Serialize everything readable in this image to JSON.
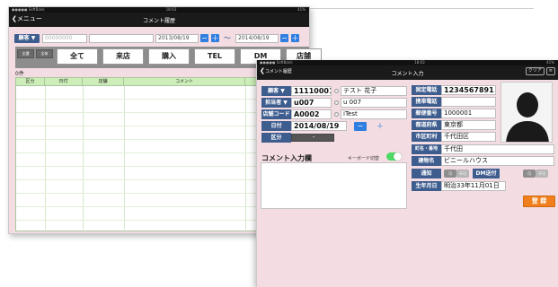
{
  "back": {
    "status": {
      "carrier": "●●●●● SoftBank",
      "time": "18:03",
      "battery": "41%"
    },
    "nav": {
      "back_label": "メニュー",
      "title": "コメント履歴"
    },
    "filter": {
      "customer_label": "顧客 ▼",
      "customer_placeholder": "00000000",
      "customer_name": "",
      "date_from": "2013/08/19",
      "date_to": "2014/08/19",
      "minus": "−",
      "plus": "＋",
      "wave": "〜"
    },
    "mini_buttons": [
      "全選",
      "全体"
    ],
    "tabs": [
      "全て",
      "来店",
      "購入",
      "TEL",
      "DM",
      "店舗"
    ],
    "count": "0件",
    "grid_headers": [
      "区分",
      "日付",
      "店舗",
      "コメント"
    ]
  },
  "front": {
    "status": {
      "carrier": "●●●●● SoftBank",
      "time": "18:03",
      "battery": "41%"
    },
    "nav": {
      "back_label": "コメント履歴",
      "title": "コメント入力",
      "clear": "クリア",
      "menu": "≡"
    },
    "customer": {
      "label": "顧客 ▼",
      "code": "11110001",
      "name": "テスト 花子"
    },
    "staff": {
      "label": "担当者 ▼",
      "code": "u007",
      "name": "u 007"
    },
    "store": {
      "label": "店舗コード",
      "code": "A0002",
      "name": "iTest"
    },
    "date": {
      "label": "日付",
      "value": "2014/08/19",
      "minus": "−",
      "plus": "＋"
    },
    "category": {
      "label": "区分",
      "value": "-"
    },
    "comment": {
      "title": "コメント入力欄",
      "keyboard_label": "キーボード切替",
      "value": ""
    },
    "info": [
      {
        "label": "固定電話",
        "value": "1234567891"
      },
      {
        "label": "携帯電話",
        "value": ""
      },
      {
        "label": "郵便番号",
        "value": "1000001"
      },
      {
        "label": "都道府県",
        "value": "東京都"
      },
      {
        "label": "市区町村",
        "value": "千代田区"
      },
      {
        "label": "町名・番地",
        "value": "千代田"
      },
      {
        "label": "建物名",
        "value": "ビニールハウス"
      }
    ],
    "notice": {
      "label": "通知",
      "on": "可",
      "off": "不可"
    },
    "dm": {
      "label": "DM送付",
      "on": "可",
      "off": "不可"
    },
    "birthday": {
      "label": "生年月日",
      "value": "明治33年11月01日"
    },
    "register": "登 録",
    "colors": {
      "label_bg": "#3e5d8f",
      "accent": "#f07f1e",
      "toggle": "#4cd964"
    }
  }
}
